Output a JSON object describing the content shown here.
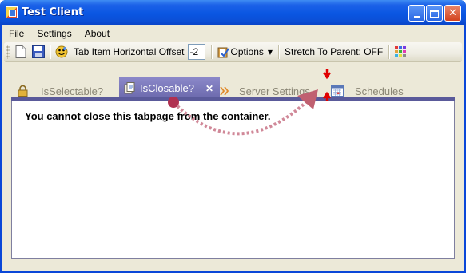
{
  "window": {
    "title": "Test Client"
  },
  "menu": {
    "items": [
      "File",
      "Settings",
      "About"
    ]
  },
  "toolbar": {
    "offset_label": "Tab Item Horizontal Offset",
    "offset_value": "-2",
    "options_label": "Options",
    "stretch_label": "Stretch To Parent: OFF"
  },
  "tabs": [
    {
      "label": "IsSelectable?",
      "icon": "lock-icon",
      "active": false
    },
    {
      "label": "IsClosable?",
      "icon": "document-icon",
      "active": true
    },
    {
      "label": "Server Settings",
      "icon": "double-chevron-icon",
      "active": false
    },
    {
      "label": "Schedules",
      "icon": "calendar-icon",
      "active": false
    }
  ],
  "content": {
    "message": "You cannot close this tabpage from the container."
  },
  "colors": {
    "titlebar": "#0a56e2",
    "client_bg": "#ece9d8",
    "active_tab": "#6b69ac",
    "tab_underline": "#5a5a9a",
    "drag_arrow": "#b03050",
    "insert_marker": "#e00000"
  }
}
